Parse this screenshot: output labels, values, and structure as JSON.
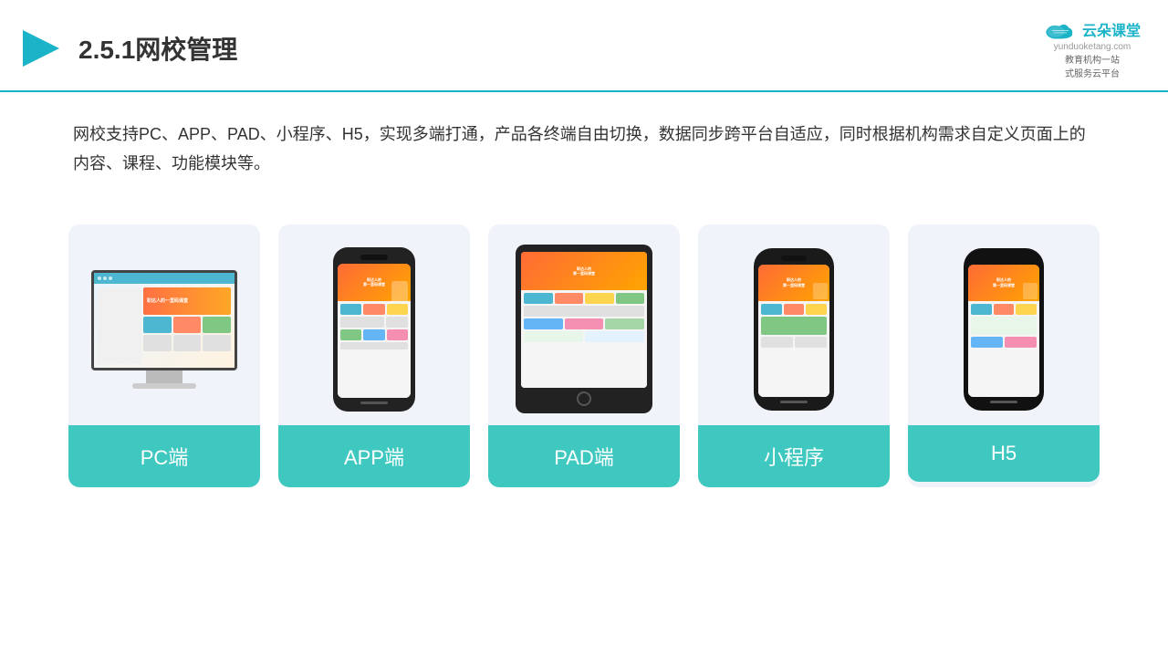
{
  "header": {
    "title": "2.5.1网校管理",
    "logo_main": "云朵课堂",
    "logo_domain": "yunduoketang.com",
    "logo_slogan": "教育机构一站\n式服务云平台"
  },
  "description": {
    "text": "网校支持PC、APP、PAD、小程序、H5，实现多端打通，产品各终端自由切换，数据同步跨平台自适应，同时根据机构需求自定义页面上的内容、课程、功能模块等。"
  },
  "cards": [
    {
      "id": "pc",
      "label": "PC端"
    },
    {
      "id": "app",
      "label": "APP端"
    },
    {
      "id": "pad",
      "label": "PAD端"
    },
    {
      "id": "miniprogram",
      "label": "小程序"
    },
    {
      "id": "h5",
      "label": "H5"
    }
  ],
  "colors": {
    "accent": "#3ec8c0",
    "header_line": "#1ab3c8",
    "card_bg": "#f0f4fa",
    "title_color": "#333333"
  }
}
